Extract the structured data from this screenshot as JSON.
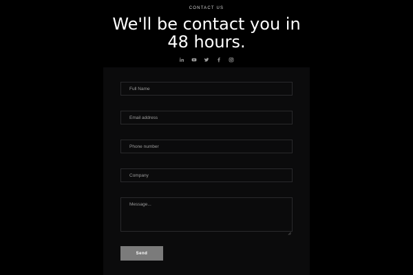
{
  "header": {
    "eyebrow": "CONTACT US",
    "title_line1": "We'll be contact you in",
    "title_line2": "48 hours."
  },
  "social": [
    {
      "name": "linkedin-icon"
    },
    {
      "name": "youtube-icon"
    },
    {
      "name": "twitter-icon"
    },
    {
      "name": "facebook-icon"
    },
    {
      "name": "instagram-icon"
    }
  ],
  "form": {
    "full_name": {
      "placeholder": "Full Name",
      "value": ""
    },
    "email": {
      "placeholder": "Email address",
      "value": ""
    },
    "phone": {
      "placeholder": "Phone number",
      "value": ""
    },
    "company": {
      "placeholder": "Company",
      "value": ""
    },
    "message": {
      "placeholder": "Message...",
      "value": ""
    },
    "send_label": "Send"
  },
  "colors": {
    "background": "#000000",
    "panel": "#0b0b0c",
    "field_border": "#2a2a2c",
    "button": "#7b7b7b",
    "text": "#ffffff"
  }
}
